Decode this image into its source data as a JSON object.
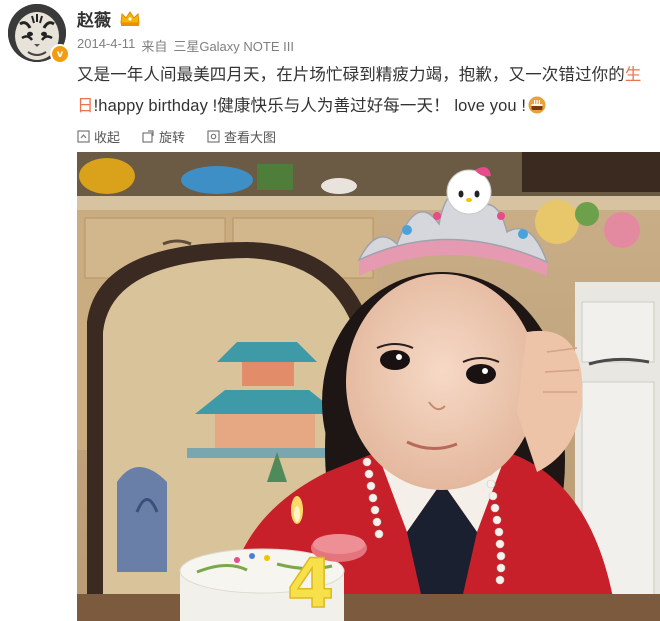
{
  "user": {
    "name": "赵薇",
    "verified_badge": "v",
    "badge_icon": "crown-icon",
    "avatar_icon": "tiger-avatar-icon"
  },
  "meta": {
    "date": "2014-4-11",
    "source_prefix": "来自",
    "source_device": "三星Galaxy NOTE III"
  },
  "post": {
    "text_part1": "又是一年人间最美四月天，在片场忙碌到精疲力竭，抱歉，又一次错过你的",
    "text_highlight": "生日",
    "text_part2": "!happy birthday !健康快乐与人为善过好每一天！ love you !",
    "emoji": "cake-icon"
  },
  "toolbar": {
    "collapse_label": "收起",
    "rotate_label": "旋转",
    "view_large_label": "查看大图"
  },
  "photo": {
    "cake_number": "4"
  },
  "colors": {
    "highlight": "#eb7350",
    "meta_gray": "#808080",
    "cardigan_red": "#c8202a"
  }
}
